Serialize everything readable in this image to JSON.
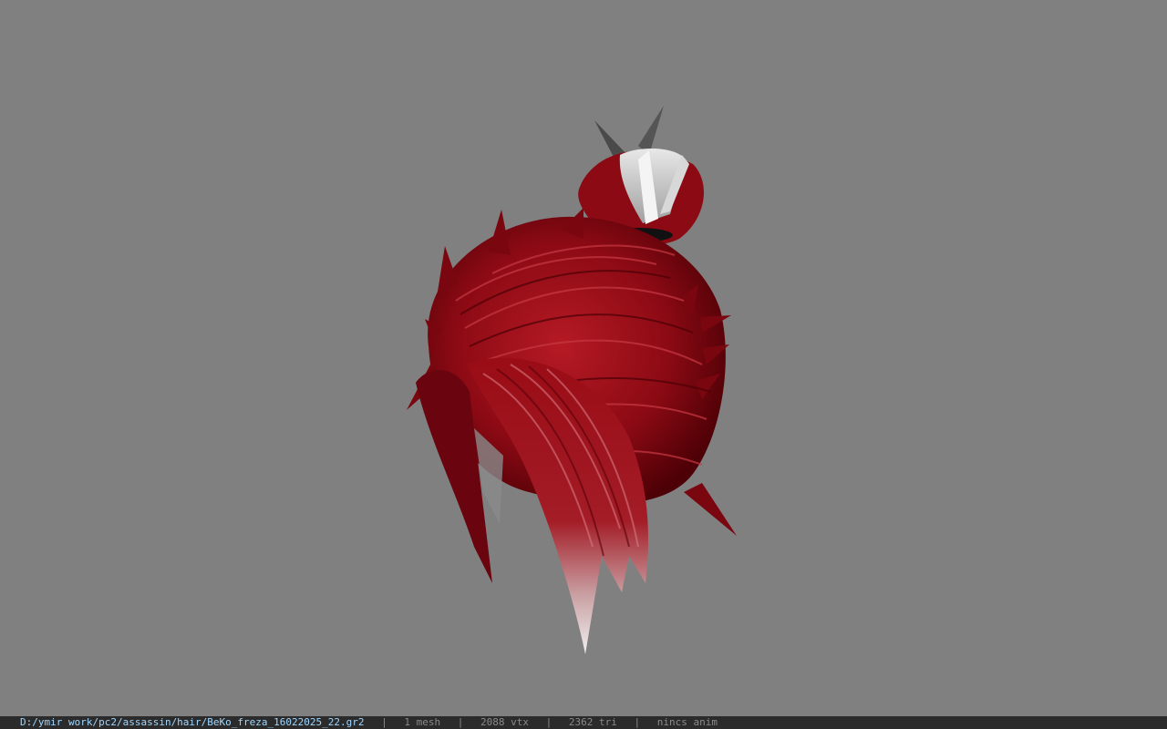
{
  "viewport": {
    "background": "#808080",
    "model": {
      "name": "BeKo_freza_16022025_22",
      "colors": {
        "hair_dark": "#5a0008",
        "hair_mid": "#8c0a14",
        "hair_light": "#b51a24",
        "tip_white": "#e6e6e6",
        "band": "#111111",
        "spike_grey": "#4a4a4a"
      }
    }
  },
  "statusbar": {
    "path": "D:/ymir work/pc2/assassin/hair/BeKo_freza_16022025_22.gr2",
    "sep1": "|",
    "mesh": "1 mesh",
    "sep2": "|",
    "vtx": "2088 vtx",
    "sep3": "|",
    "tri": "2362 tri",
    "sep4": "|",
    "anim": "nincs anim"
  }
}
